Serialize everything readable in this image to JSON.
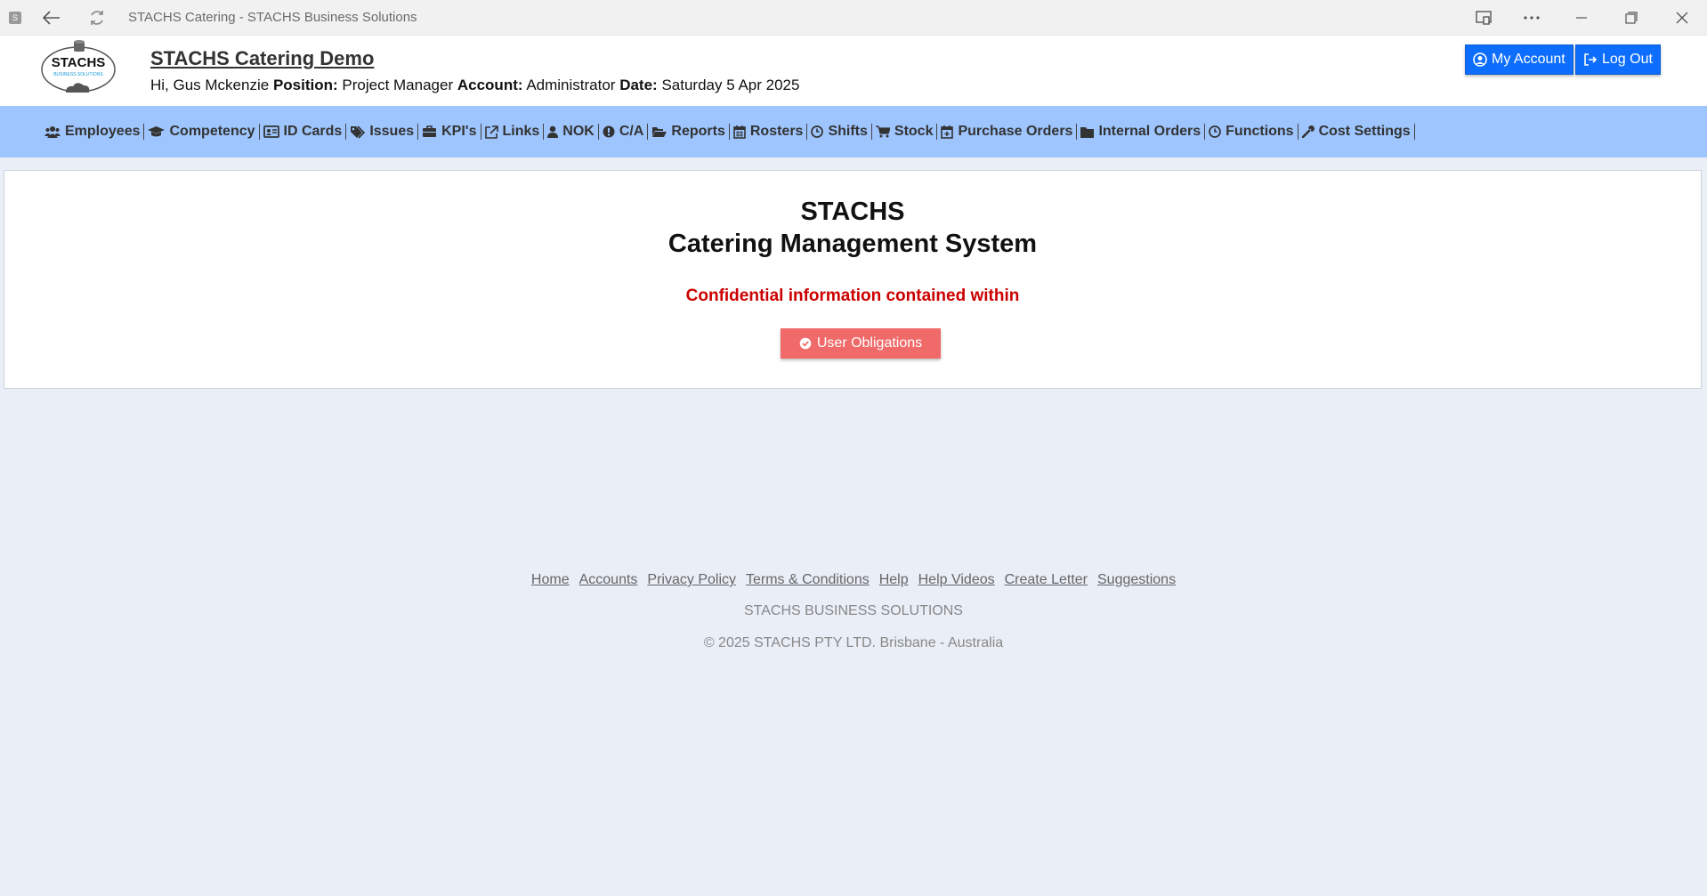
{
  "window": {
    "title": "STACHS Catering - STACHS Business Solutions",
    "app_icon_letter": "S"
  },
  "header": {
    "logo_text": "STACHS",
    "logo_subtext": "BUSINESS SOLUTIONS",
    "site_title": "STACHS Catering Demo",
    "greeting": "Hi, Gus Mckenzie",
    "position_label": "Position:",
    "position_value": "Project Manager",
    "account_label": "Account:",
    "account_value": "Administrator",
    "date_label": "Date:",
    "date_value": "Saturday 5 Apr 2025",
    "my_account_label": "My Account",
    "log_out_label": "Log Out"
  },
  "nav": {
    "items": [
      {
        "label": "Employees",
        "icon": "users-icon"
      },
      {
        "label": "Competency",
        "icon": "graduation-cap-icon"
      },
      {
        "label": "ID Cards",
        "icon": "id-card-icon"
      },
      {
        "label": "Issues",
        "icon": "tags-icon"
      },
      {
        "label": "KPI's",
        "icon": "briefcase-icon"
      },
      {
        "label": "Links",
        "icon": "external-link-icon"
      },
      {
        "label": "NOK",
        "icon": "user-icon"
      },
      {
        "label": "C/A",
        "icon": "exclamation-circle-icon"
      },
      {
        "label": "Reports",
        "icon": "folder-open-icon"
      },
      {
        "label": "Rosters",
        "icon": "calendar-icon"
      },
      {
        "label": "Shifts",
        "icon": "clock-icon"
      },
      {
        "label": "Stock",
        "icon": "cart-icon"
      },
      {
        "label": "Purchase Orders",
        "icon": "calendar-plus-icon"
      },
      {
        "label": "Internal Orders",
        "icon": "folder-icon"
      },
      {
        "label": "Functions",
        "icon": "clock-icon"
      },
      {
        "label": "Cost Settings",
        "icon": "wrench-icon"
      }
    ]
  },
  "main": {
    "title_line1": "STACHS",
    "title_line2": "Catering Management System",
    "confidential": "Confidential information contained within",
    "obligations_button": "User Obligations"
  },
  "footer": {
    "links": [
      "Home",
      "Accounts",
      "Privacy Policy",
      "Terms & Conditions",
      "Help",
      "Help Videos",
      "Create Letter",
      "Suggestions"
    ],
    "company": "STACHS BUSINESS SOLUTIONS",
    "copyright": "© 2025 STACHS PTY LTD. Brisbane - Australia"
  },
  "colors": {
    "nav_background": "#9ec5fe",
    "page_background": "#e9eef7",
    "primary_button": "#0d6efd",
    "obligations_button": "#f06a6a",
    "confidential_text": "#cc0000"
  }
}
